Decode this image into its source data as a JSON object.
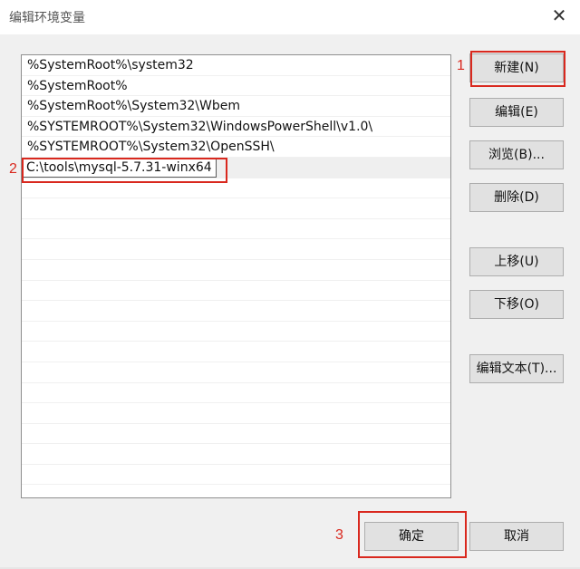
{
  "window": {
    "title": "编辑环境变量",
    "close_icon": "close-icon"
  },
  "list": {
    "items": [
      "%SystemRoot%\\system32",
      "%SystemRoot%",
      "%SystemRoot%\\System32\\Wbem",
      "%SYSTEMROOT%\\System32\\WindowsPowerShell\\v1.0\\",
      "%SYSTEMROOT%\\System32\\OpenSSH\\",
      "C:\\tools\\mysql-5.7.31-winx64"
    ],
    "editing_index": 5
  },
  "buttons": {
    "new": "新建(N)",
    "edit": "编辑(E)",
    "browse": "浏览(B)...",
    "delete": "删除(D)",
    "move_up": "上移(U)",
    "move_down": "下移(O)",
    "edit_text": "编辑文本(T)...",
    "ok": "确定",
    "cancel": "取消"
  },
  "annotations": {
    "marker1": "1",
    "marker2": "2",
    "marker3": "3",
    "color": "#d9281e"
  }
}
